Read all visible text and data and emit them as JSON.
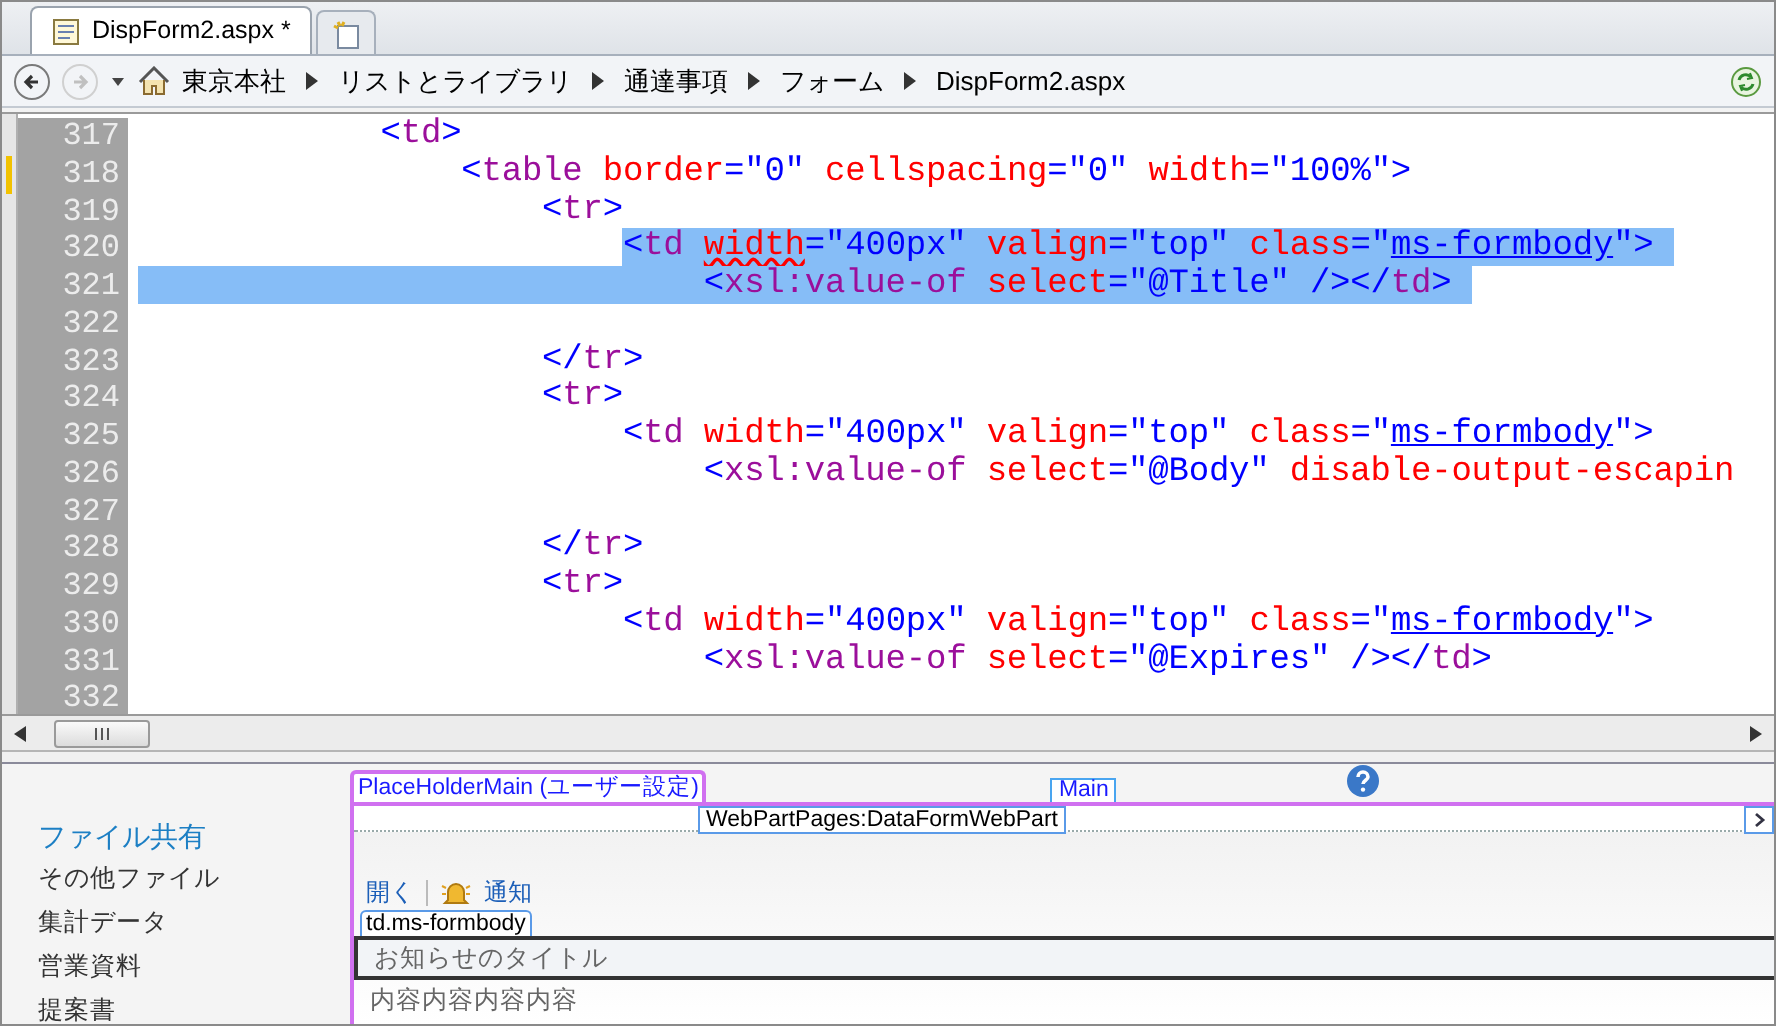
{
  "tabs": [
    {
      "label": "DispForm2.aspx *",
      "selected": true
    }
  ],
  "navigation": {
    "back_disabled": false,
    "forward_disabled": true
  },
  "breadcrumb": [
    {
      "label": "東京本社",
      "kind": "home"
    },
    {
      "label": "リストとライブラリ",
      "kind": "plain"
    },
    {
      "label": "通達事項",
      "kind": "plain"
    },
    {
      "label": "フォーム",
      "kind": "plain"
    },
    {
      "label": "DispForm2.aspx",
      "kind": "plain"
    }
  ],
  "editor": {
    "lines": [
      {
        "number": "317",
        "tokens": [
          {
            "kind": "punct",
            "text": "            <"
          },
          {
            "kind": "tag",
            "text": "td"
          },
          {
            "kind": "punct",
            "text": ">"
          }
        ]
      },
      {
        "number": "318",
        "tokens": [
          {
            "kind": "punct",
            "text": "                <"
          },
          {
            "kind": "tag",
            "text": "table"
          },
          {
            "kind": "attr",
            "text": " border"
          },
          {
            "kind": "punct",
            "text": "=\"0\""
          },
          {
            "kind": "attr",
            "text": " cellspacing"
          },
          {
            "kind": "punct",
            "text": "=\"0\""
          },
          {
            "kind": "attr",
            "text": " width"
          },
          {
            "kind": "punct",
            "text": "=\"100%\">"
          }
        ]
      },
      {
        "number": "319",
        "tokens": [
          {
            "kind": "punct",
            "text": "                    <"
          },
          {
            "kind": "tag",
            "text": "tr"
          },
          {
            "kind": "punct",
            "text": ">"
          }
        ]
      },
      {
        "number": "320",
        "highlighted": true,
        "tokens": [
          {
            "kind": "punct",
            "text": "                        <"
          },
          {
            "kind": "tag",
            "text": "td"
          },
          {
            "kind": "misspelled",
            "text": " width"
          },
          {
            "kind": "punct",
            "text": "=\"400px\""
          },
          {
            "kind": "attr",
            "text": " valign"
          },
          {
            "kind": "punct",
            "text": "=\"top\""
          },
          {
            "kind": "attr",
            "text": " class"
          },
          {
            "kind": "punct",
            "text": "=\""
          },
          {
            "kind": "link",
            "text": "ms-formbody"
          },
          {
            "kind": "punct",
            "text": "\">"
          }
        ]
      },
      {
        "number": "321",
        "highlighted": true,
        "tokens": [
          {
            "kind": "punct",
            "text": "                            <"
          },
          {
            "kind": "tag",
            "text": "xsl:value-of"
          },
          {
            "kind": "attr",
            "text": " select"
          },
          {
            "kind": "punct",
            "text": "=\"@Title\" /></"
          },
          {
            "kind": "tag",
            "text": "td"
          },
          {
            "kind": "punct",
            "text": ">"
          }
        ]
      },
      {
        "number": "322"
      },
      {
        "number": "323",
        "tokens": [
          {
            "kind": "punct",
            "text": "                    </"
          },
          {
            "kind": "tag",
            "text": "tr"
          },
          {
            "kind": "punct",
            "text": ">"
          }
        ]
      },
      {
        "number": "324",
        "tokens": [
          {
            "kind": "punct",
            "text": "                    <"
          },
          {
            "kind": "tag",
            "text": "tr"
          },
          {
            "kind": "punct",
            "text": ">"
          }
        ]
      },
      {
        "number": "325",
        "tokens": [
          {
            "kind": "punct",
            "text": "                        <"
          },
          {
            "kind": "tag",
            "text": "td"
          },
          {
            "kind": "attr",
            "text": " width"
          },
          {
            "kind": "punct",
            "text": "=\"400px\""
          },
          {
            "kind": "attr",
            "text": " valign"
          },
          {
            "kind": "punct",
            "text": "=\"top\""
          },
          {
            "kind": "attr",
            "text": " class"
          },
          {
            "kind": "punct",
            "text": "=\""
          },
          {
            "kind": "link",
            "text": "ms-formbody"
          },
          {
            "kind": "punct",
            "text": "\">"
          }
        ]
      },
      {
        "number": "326",
        "tokens": [
          {
            "kind": "punct",
            "text": "                            <"
          },
          {
            "kind": "tag",
            "text": "xsl:value-of"
          },
          {
            "kind": "attr",
            "text": " select"
          },
          {
            "kind": "punct",
            "text": "=\"@Body\""
          },
          {
            "kind": "attr",
            "text": " disable-output-escapin"
          }
        ]
      },
      {
        "number": "327"
      },
      {
        "number": "328",
        "tokens": [
          {
            "kind": "punct",
            "text": "                    </"
          },
          {
            "kind": "tag",
            "text": "tr"
          },
          {
            "kind": "punct",
            "text": ">"
          }
        ]
      },
      {
        "number": "329",
        "tokens": [
          {
            "kind": "punct",
            "text": "                    <"
          },
          {
            "kind": "tag",
            "text": "tr"
          },
          {
            "kind": "punct",
            "text": ">"
          }
        ]
      },
      {
        "number": "330",
        "tokens": [
          {
            "kind": "punct",
            "text": "                        <"
          },
          {
            "kind": "tag",
            "text": "td"
          },
          {
            "kind": "attr",
            "text": " width"
          },
          {
            "kind": "punct",
            "text": "=\"400px\""
          },
          {
            "kind": "attr",
            "text": " valign"
          },
          {
            "kind": "punct",
            "text": "=\"top\""
          },
          {
            "kind": "attr",
            "text": " class"
          },
          {
            "kind": "punct",
            "text": "=\""
          },
          {
            "kind": "link",
            "text": "ms-formbody"
          },
          {
            "kind": "punct",
            "text": "\">"
          }
        ]
      },
      {
        "number": "331",
        "tokens": [
          {
            "kind": "punct",
            "text": "                            <"
          },
          {
            "kind": "tag",
            "text": "xsl:value-of"
          },
          {
            "kind": "attr",
            "text": " select"
          },
          {
            "kind": "punct",
            "text": "=\"@Expires\" /></"
          },
          {
            "kind": "tag",
            "text": "td"
          },
          {
            "kind": "punct",
            "text": ">"
          }
        ]
      },
      {
        "number": "332"
      }
    ]
  },
  "sidebar": {
    "items": [
      {
        "label": "ファイル共有",
        "kind": "heading"
      },
      {
        "label": "その他ファイル",
        "kind": "link"
      },
      {
        "label": "集計データ",
        "kind": "link"
      },
      {
        "label": "営業資料",
        "kind": "link"
      },
      {
        "label": "提案書",
        "kind": "link"
      }
    ]
  },
  "design": {
    "placeholder_label": "PlaceHolderMain (ユーザー設定)",
    "region_label": "Main",
    "webpart_label": "WebPartPages:DataFormWebPart",
    "toolbar": [
      {
        "label": "開く",
        "kind": "plain"
      },
      {
        "label": "通知",
        "kind": "bell"
      }
    ],
    "cell_label": "td.ms-formbody",
    "title_field": "お知らせのタイトル",
    "body_text": "内容内容内容内容"
  }
}
